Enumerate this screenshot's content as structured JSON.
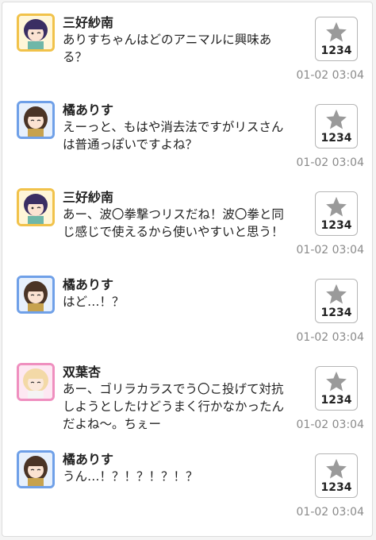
{
  "colors": {
    "avatar_sanae_border": "#f1c24a",
    "avatar_arisu_border": "#6fa0e8",
    "avatar_anzu_border": "#ef8fbf",
    "star": "#9a9a9a"
  },
  "messages": [
    {
      "speaker": "三好紗南",
      "avatar": "sanae",
      "text": "ありすちゃんはどのアニマルに興味ある？",
      "likes": "1234",
      "time": "01-02 03:04"
    },
    {
      "speaker": "橘ありす",
      "avatar": "arisu",
      "text": "えーっと、もはや消去法ですがリスさんは普通っぽいですよね？",
      "likes": "1234",
      "time": "01-02 03:04"
    },
    {
      "speaker": "三好紗南",
      "avatar": "sanae",
      "text": "あー、波〇拳撃つリスだね！波〇拳と同じ感じで使えるから使いやすいと思う！",
      "likes": "1234",
      "time": "01-02 03:04"
    },
    {
      "speaker": "橘ありす",
      "avatar": "arisu",
      "text": "はど…！？",
      "likes": "1234",
      "time": "01-02 03:04"
    },
    {
      "speaker": "双葉杏",
      "avatar": "anzu",
      "text": "あー、ゴリラカラスでう〇こ投げて対抗しようとしたけどうまく行かなかったんだよね〜。ちぇー",
      "likes": "1234",
      "time": "01-02 03:04"
    },
    {
      "speaker": "橘ありす",
      "avatar": "arisu",
      "text": "うん…！？！？！？！？",
      "likes": "1234",
      "time": "01-02 03:04"
    }
  ]
}
